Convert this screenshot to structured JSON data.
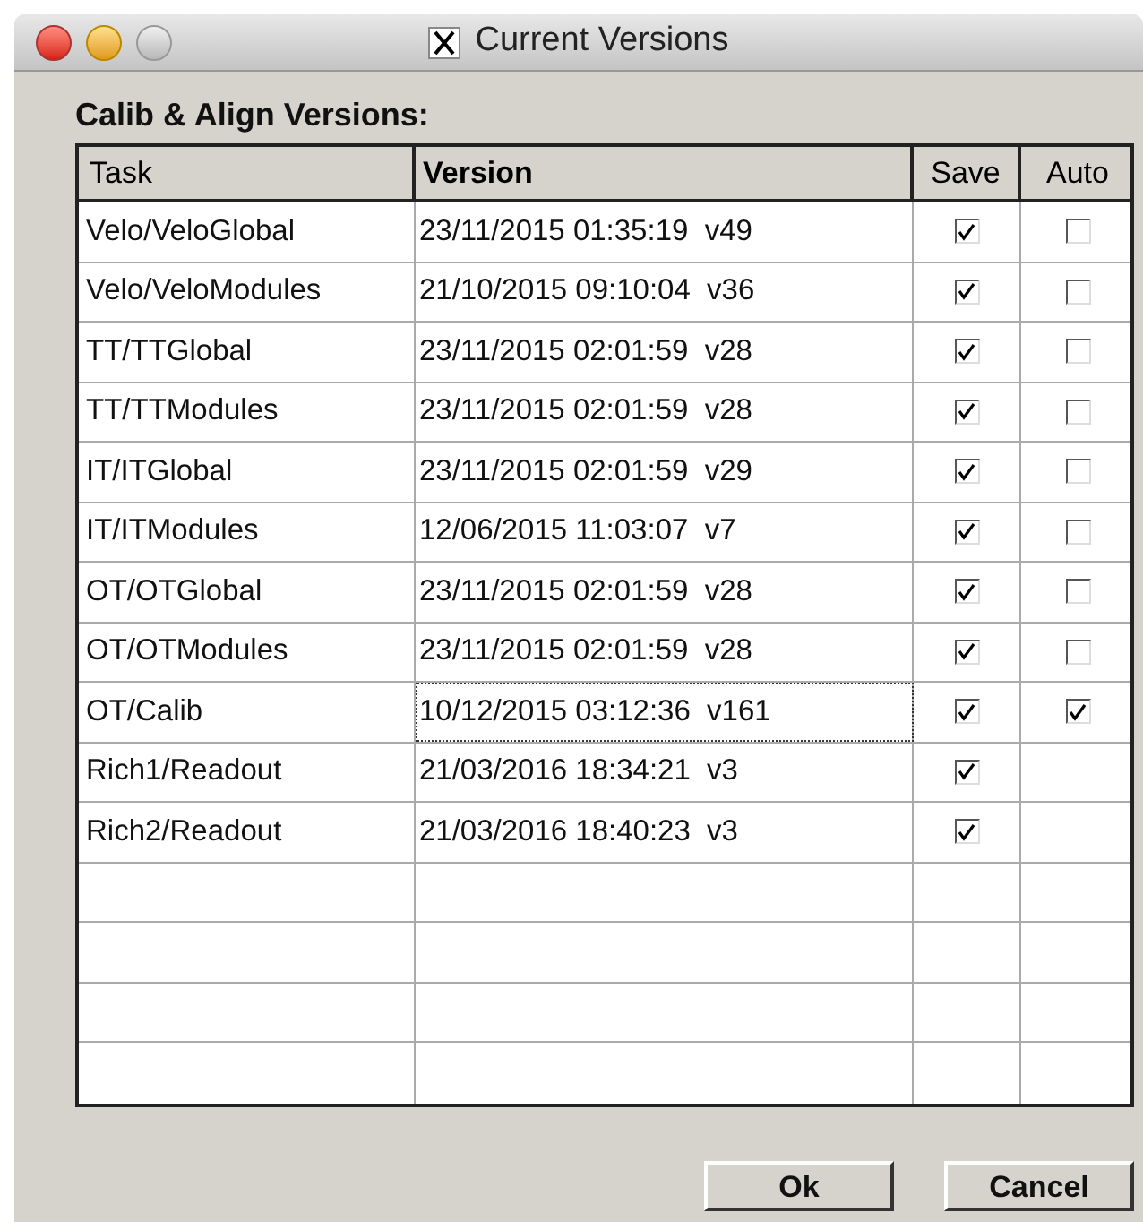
{
  "window": {
    "title": "Current Versions"
  },
  "section_title": "Calib & Align Versions:",
  "table": {
    "columns": [
      "Task",
      "Version",
      "Save",
      "Auto"
    ],
    "rows": [
      {
        "task": "Velo/VeloGlobal",
        "version": "23/11/2015 01:35:19  v49",
        "save": true,
        "auto": false,
        "focused": false
      },
      {
        "task": "Velo/VeloModules",
        "version": "21/10/2015 09:10:04  v36",
        "save": true,
        "auto": false,
        "focused": false
      },
      {
        "task": "TT/TTGlobal",
        "version": "23/11/2015 02:01:59  v28",
        "save": true,
        "auto": false,
        "focused": false
      },
      {
        "task": "TT/TTModules",
        "version": "23/11/2015 02:01:59  v28",
        "save": true,
        "auto": false,
        "focused": false
      },
      {
        "task": "IT/ITGlobal",
        "version": "23/11/2015 02:01:59  v29",
        "save": true,
        "auto": false,
        "focused": false
      },
      {
        "task": "IT/ITModules",
        "version": "12/06/2015 11:03:07  v7",
        "save": true,
        "auto": false,
        "focused": false
      },
      {
        "task": "OT/OTGlobal",
        "version": "23/11/2015 02:01:59  v28",
        "save": true,
        "auto": false,
        "focused": false
      },
      {
        "task": "OT/OTModules",
        "version": "23/11/2015 02:01:59  v28",
        "save": true,
        "auto": false,
        "focused": false
      },
      {
        "task": "OT/Calib",
        "version": "10/12/2015 03:12:36  v161",
        "save": true,
        "auto": true,
        "focused": true
      },
      {
        "task": "Rich1/Readout",
        "version": "21/03/2016 18:34:21  v3",
        "save": true,
        "focused": false
      },
      {
        "task": "Rich2/Readout",
        "version": "21/03/2016 18:40:23  v3",
        "save": true,
        "focused": false
      }
    ]
  },
  "buttons": [
    "Ok",
    "Cancel"
  ]
}
